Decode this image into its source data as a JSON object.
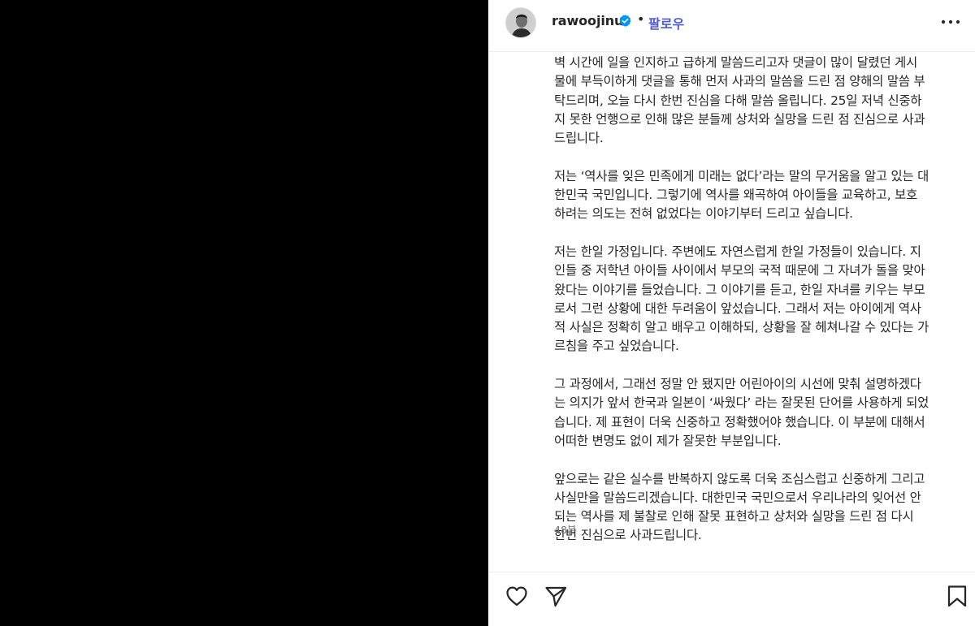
{
  "header": {
    "username": "rawoojinu",
    "separator": "•",
    "follow_label": "팔로우",
    "avatar_icon": "profile-avatar",
    "verified_icon": "verified-badge-icon",
    "more_icon": "more-options-icon"
  },
  "caption": {
    "paragraphs": [
      "벽 시간에 일을 인지하고 급하게 말씀드리고자 댓글이 많이 달렸던 게시\n물에 부득이하게 댓글을 통해 먼저 사과의 말씀을 드린 점 양해의 말씀 부\n탁드리며, 오늘 다시 한번 진심을 다해 말씀 올립니다. 25일 저녁 신중하\n지 못한 언행으로 인해 많은 분들께 상처와 실망을 드린 점 진심으로 사과\n드립니다.",
      "저는 ‘역사를 잊은 민족에게 미래는 없다’라는 말의 무거움을 알고 있는 대\n한민국 국민입니다. 그렇기에 역사를 왜곡하여 아이들을 교육하고, 보호\n하려는 의도는 전혀 없었다는 이야기부터 드리고 싶습니다.",
      "저는 한일 가정입니다. 주변에도 자연스럽게 한일 가정들이 있습니다. 지\n인들 중 저학년 아이들 사이에서 부모의 국적 때문에 그 자녀가 돌을 맞아\n왔다는 이야기를 들었습니다. 그 이야기를 듣고, 한일 자녀를 키우는 부모\n로서 그런 상황에 대한 두려움이 앞섰습니다. 그래서 저는 아이에게 역사\n적 사실은 정확히 알고 배우고 이해하되, 상황을 잘 헤쳐나갈 수 있다는 가\n르침을 주고 싶었습니다.",
      "그 과정에서, 그래선 정말 안 됐지만 어린아이의 시선에 맞춰 설명하겠다\n는 의지가 앞서 한국과 일본이 ‘싸웠다’ 라는 잘못된 단어를 사용하게 되었\n습니다. 제 표현이 더욱 신중하고 정확했어야 했습니다. 이 부분에 대해서\n어떠한 변명도 없이 제가 잘못한 부분입니다.",
      "앞으로는 같은 실수를 반복하지 않도록 더욱 조심스럽고 신중하게 그리고\n사실만을 말씀드리겠습니다. 대한민국 국민으로서 우리나라의 잊어선 안\n되는 역사를 제 불찰로 인해 잘못 표현하고 상처와 실망을 드린 점 다시\n한번 진심으로 사과드립니다."
    ],
    "timestamp": "48분"
  },
  "actions": {
    "like_icon": "heart-icon",
    "share_icon": "send-icon",
    "save_icon": "bookmark-icon"
  },
  "colors": {
    "follow": "#4f5bd5",
    "verified": "#0095f6",
    "text": "#262626",
    "muted": "#737373"
  }
}
